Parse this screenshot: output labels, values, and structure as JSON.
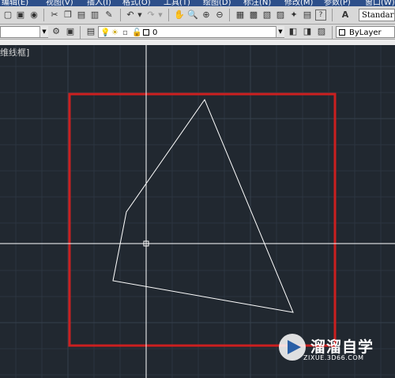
{
  "menubar": {
    "items": [
      "编辑(E)",
      "视图(V)",
      "插入(I)",
      "格式(O)",
      "工具(T)",
      "绘图(D)",
      "标注(N)",
      "修改(M)",
      "参数(P)",
      "窗口(W)"
    ]
  },
  "toolbar": {
    "text_style": "Standar"
  },
  "properties_bar": {
    "layer_name": "0",
    "linetype": "ByLayer"
  },
  "viewport": {
    "label": "维线框]",
    "background": "#212830",
    "rectangle_color": "#cc1f1f",
    "shape_color": "#ffffff"
  },
  "watermark": {
    "name": "溜溜自学",
    "url": "ZIXUE.3D66.COM"
  }
}
